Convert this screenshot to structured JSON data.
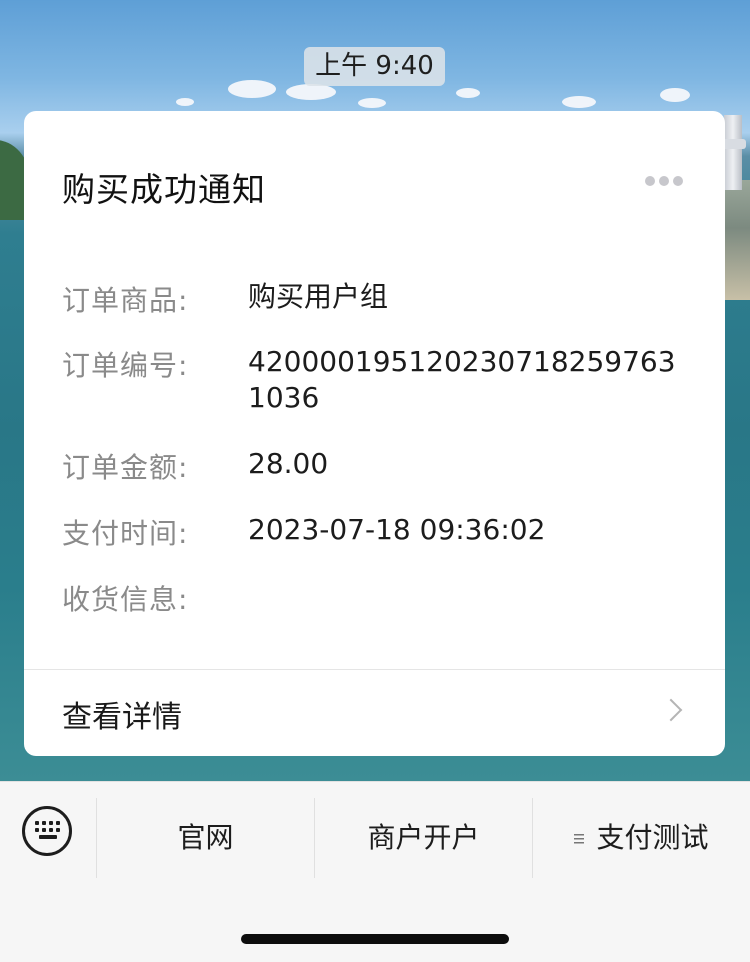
{
  "chat": {
    "timestamp": "上午 9:40"
  },
  "card": {
    "title": "购买成功通知",
    "more_icon": "ellipsis-icon",
    "fields": [
      {
        "label": "订单商品:",
        "value": "购买用户组"
      },
      {
        "label": "订单编号:",
        "value": "4200001951202307182597631036"
      },
      {
        "label": "订单金额:",
        "value": "28.00"
      },
      {
        "label": "支付时间:",
        "value": "2023-07-18 09:36:02"
      },
      {
        "label": "收货信息:",
        "value": ""
      }
    ],
    "detail_link": "查看详情"
  },
  "menu": {
    "keyboard_icon": "keyboard-icon",
    "items": [
      {
        "label": "官网"
      },
      {
        "label": "商户开户"
      },
      {
        "label": "支付测试",
        "has_submenu": true
      }
    ]
  },
  "colors": {
    "card_bg": "#ffffff",
    "label_gray": "#8a8a8a",
    "menu_bg": "#f6f6f6"
  }
}
